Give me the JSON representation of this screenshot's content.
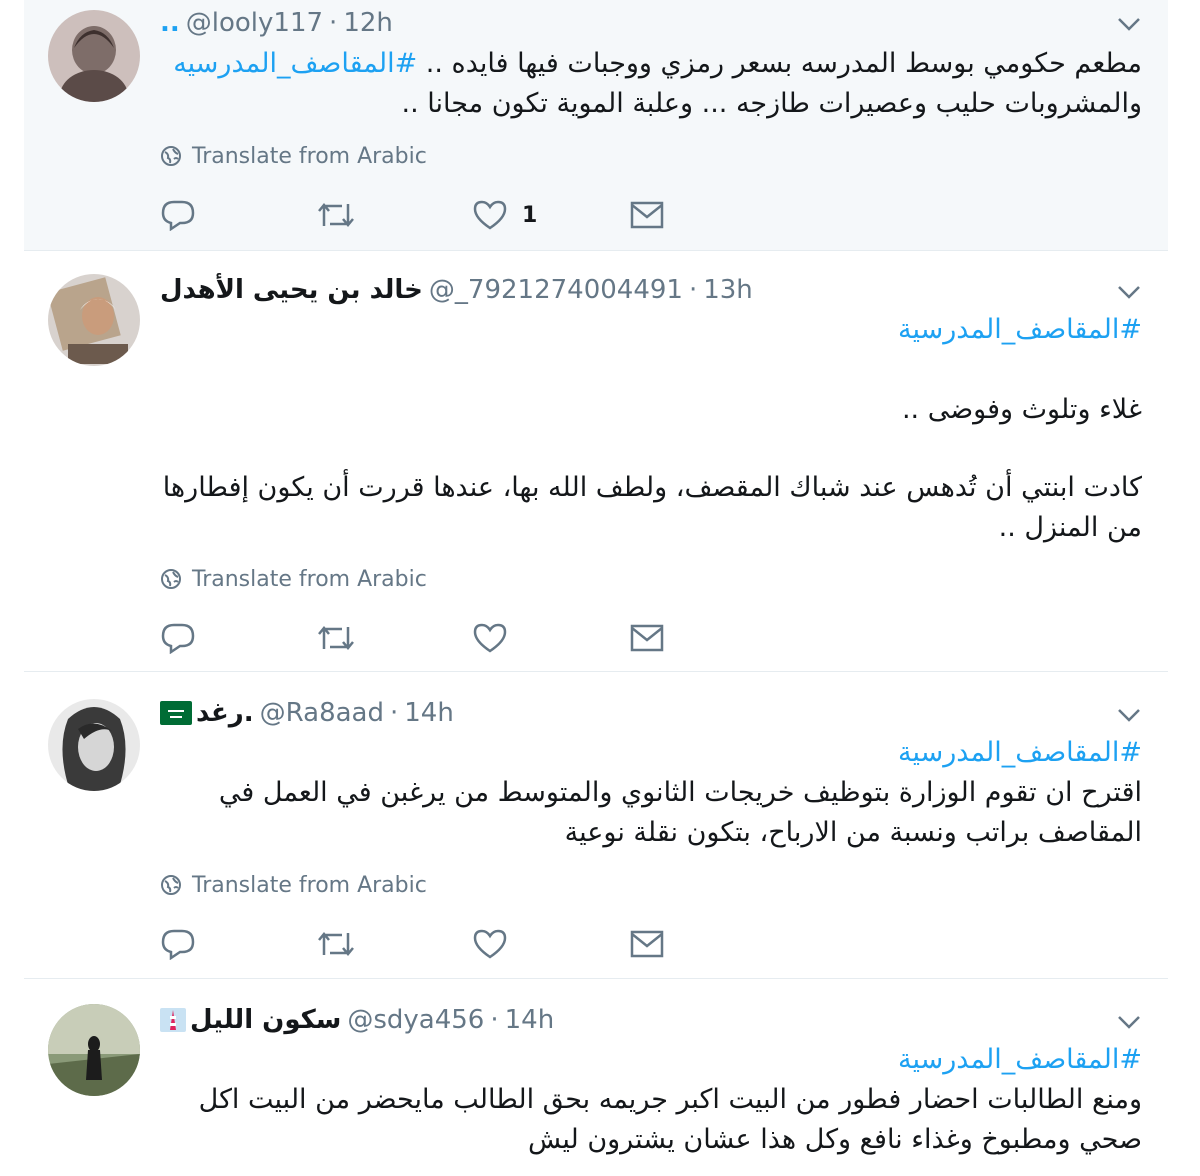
{
  "tweets": [
    {
      "name": "..",
      "handle": "@looly117",
      "time": "12h",
      "hashtag": "#المقاصف_المدرسيه",
      "lines": [
        "مطعم حكومي بوسط المدرسه بسعر رمزي ووجبات فيها فايده ..",
        "والمشروبات حليب وعصيرات طازجه ... وعلبة الموية تكون مجانا .."
      ],
      "translate_label": "Translate from Arabic",
      "like_count": "1",
      "avatar_icon": "avatar-image",
      "highlighted": true
    },
    {
      "name": "خالد بن يحيى الأهدل",
      "handle": "@_7921274004491",
      "time": "13h",
      "hashtag": "#المقاصف_المدرسية",
      "lines": [
        "غلاء وتلوث وفوضى ..",
        "كادت ابنتي أن تُدهس عند شباك المقصف، ولطف الله بها، عندها قررت أن يكون إفطارها",
        "من المنزل .."
      ],
      "translate_label": "Translate from Arabic",
      "like_count": "",
      "avatar_icon": "avatar-image",
      "highlighted": false
    },
    {
      "name": "رغد.",
      "handle": "@Ra8aad",
      "time": "14h",
      "hashtag": "#المقاصف_المدرسية",
      "lines": [
        "اقترح ان تقوم الوزارة بتوظيف خريجات الثانوي والمتوسط من يرغبن في العمل في",
        "المقاصف براتب ونسبة من الارباح، بتكون نقلة نوعية"
      ],
      "translate_label": "Translate from Arabic",
      "like_count": "",
      "avatar_icon": "avatar-image",
      "flag_icon": "saudi-flag-icon",
      "highlighted": false
    },
    {
      "name": "سكون الليل",
      "handle": "@sdya456",
      "time": "14h",
      "hashtag": "#المقاصف_المدرسية",
      "lines": [
        "ومنع الطالبات احضار فطور من البيت اكبر جريمه بحق الطالب مايحضر من البيت اكل",
        "صحي ومطبوخ وغذاء نافع وكل هذا عشان يشترون ليش"
      ],
      "translate_label": "",
      "like_count": "",
      "avatar_icon": "avatar-image",
      "flag_icon": "tower-emoji-icon",
      "highlighted": false
    }
  ],
  "icons": {
    "reply": "reply-icon",
    "retweet": "retweet-icon",
    "like": "heart-icon",
    "dm": "envelope-icon",
    "globe": "globe-icon",
    "caret": "chevron-down-icon"
  },
  "colors": {
    "link": "#1da1f2",
    "secondary_text": "#657786",
    "highlight_bg": "#f5f8fa",
    "divider": "#e6ecf0"
  }
}
